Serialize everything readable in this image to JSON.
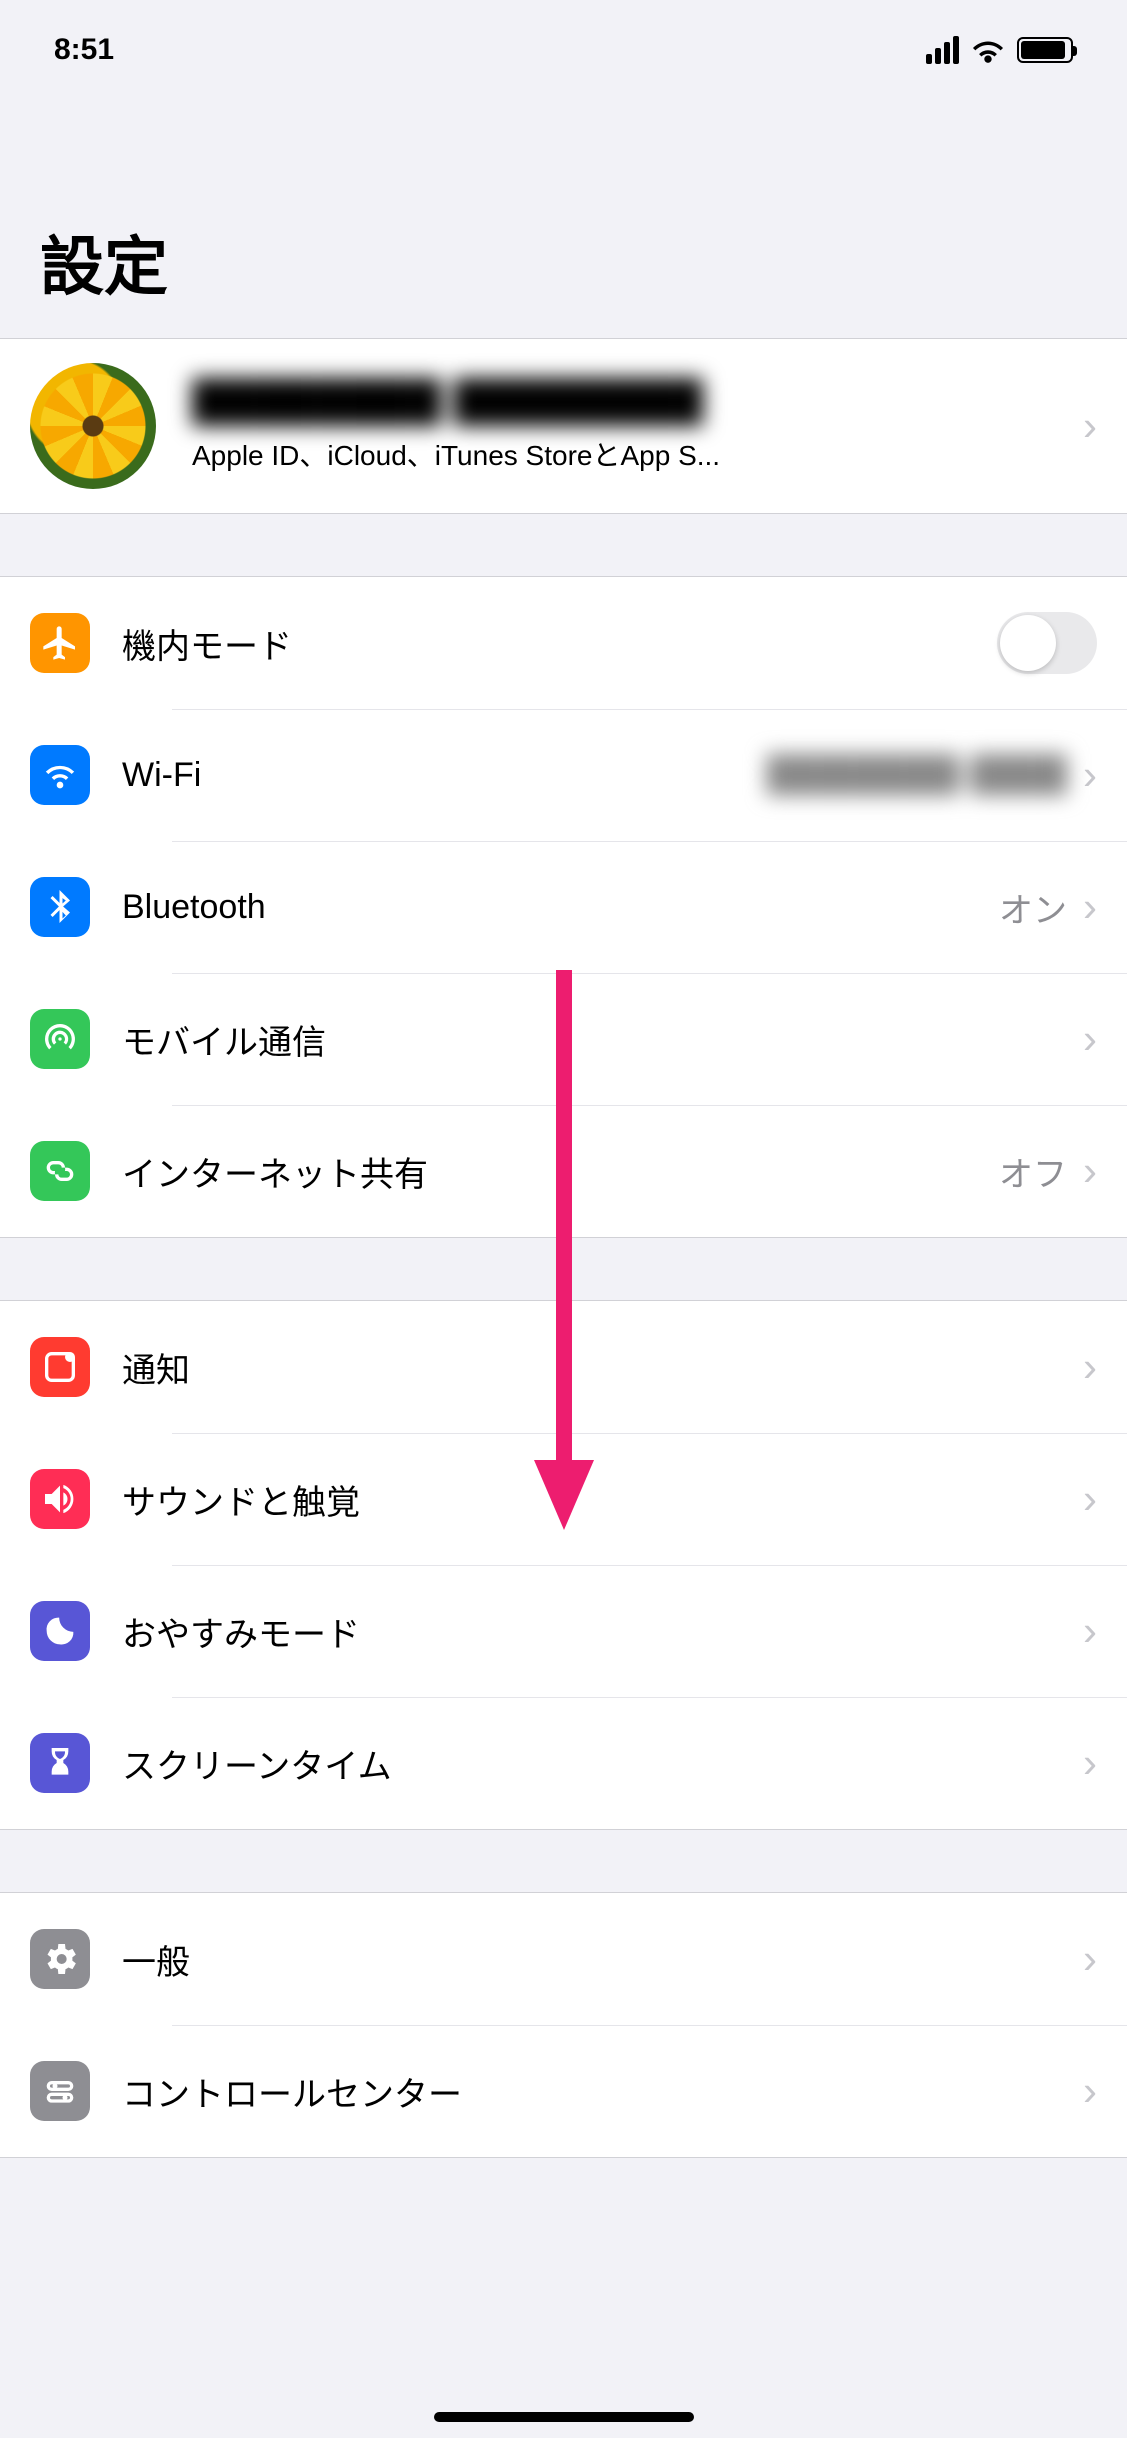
{
  "status": {
    "time": "8:51"
  },
  "page": {
    "title": "設定"
  },
  "profile": {
    "name": "████████ ████████",
    "subtitle": "Apple ID、iCloud、iTunes StoreとApp S..."
  },
  "group1": {
    "airplane": {
      "label": "機内モード"
    },
    "wifi": {
      "label": "Wi-Fi",
      "value": "████████-████"
    },
    "bluetooth": {
      "label": "Bluetooth",
      "value": "オン"
    },
    "cellular": {
      "label": "モバイル通信"
    },
    "hotspot": {
      "label": "インターネット共有",
      "value": "オフ"
    }
  },
  "group2": {
    "notifications": {
      "label": "通知"
    },
    "sounds": {
      "label": "サウンドと触覚"
    },
    "dnd": {
      "label": "おやすみモード"
    },
    "screentime": {
      "label": "スクリーンタイム"
    }
  },
  "group3": {
    "general": {
      "label": "一般"
    },
    "controlcenter": {
      "label": "コントロールセンター"
    }
  }
}
